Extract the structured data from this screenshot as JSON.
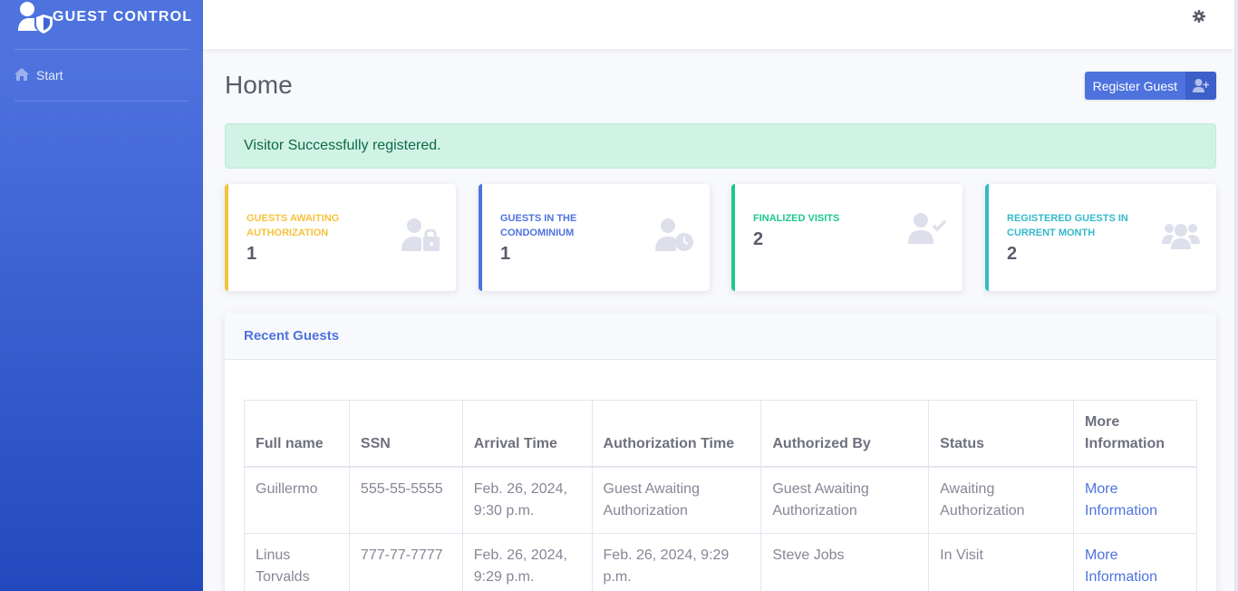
{
  "app": {
    "brand": "GUEST CONTROL"
  },
  "sidebar": {
    "items": [
      {
        "label": "Start",
        "icon": "home-icon"
      }
    ]
  },
  "page": {
    "title": "Home",
    "register_button": "Register Guest",
    "alert": "Visitor Successfully registered."
  },
  "stats": [
    {
      "label": "GUESTS AWAITING AUTHORIZATION",
      "value": "1",
      "color": "#f6c23e",
      "icon": "user-lock-icon"
    },
    {
      "label": "GUESTS IN THE CONDOMINIUM",
      "value": "1",
      "color": "#4e73df",
      "icon": "user-clock-icon"
    },
    {
      "label": "FINALIZED VISITS",
      "value": "2",
      "color": "#1cc88a",
      "icon": "user-check-icon"
    },
    {
      "label": "REGISTERED GUESTS IN CURRENT MONTH",
      "value": "2",
      "color": "#36b9cc",
      "icon": "users-icon"
    }
  ],
  "recent": {
    "title": "Recent Guests",
    "columns": [
      "Full name",
      "SSN",
      "Arrival Time",
      "Authorization Time",
      "Authorized By",
      "Status",
      "More Information"
    ],
    "rows": [
      [
        "Guillermo",
        "555-55-5555",
        "Feb. 26, 2024, 9:30 p.m.",
        "Guest Awaiting Authorization",
        "Guest Awaiting Authorization",
        "Awaiting Authorization",
        "More Information"
      ],
      [
        "Linus Torvalds",
        "777-77-7777",
        "Feb. 26, 2024, 9:29 p.m.",
        "Feb. 26, 2024, 9:29 p.m.",
        "Steve Jobs",
        "In Visit",
        "More Information"
      ]
    ]
  }
}
